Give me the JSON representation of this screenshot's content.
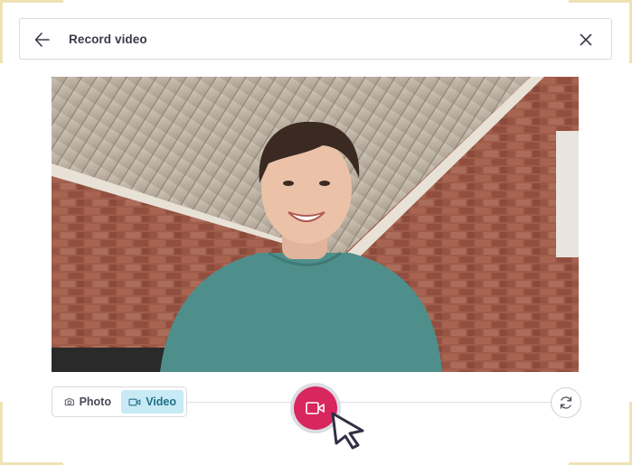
{
  "header": {
    "title": "Record video",
    "back_icon": "arrow-left-icon",
    "close_icon": "close-icon"
  },
  "camera": {
    "modes": [
      {
        "label": "Photo",
        "icon": "camera-icon",
        "active": false
      },
      {
        "label": "Video",
        "icon": "video-icon",
        "active": true
      }
    ],
    "record_icon": "video-icon",
    "flip_icon": "refresh-icon"
  },
  "colors": {
    "record": "#d8265f",
    "active_mode_bg": "#c7eaf4",
    "active_mode_text": "#1f6f8a",
    "corner_accent": "#efe3b5"
  }
}
